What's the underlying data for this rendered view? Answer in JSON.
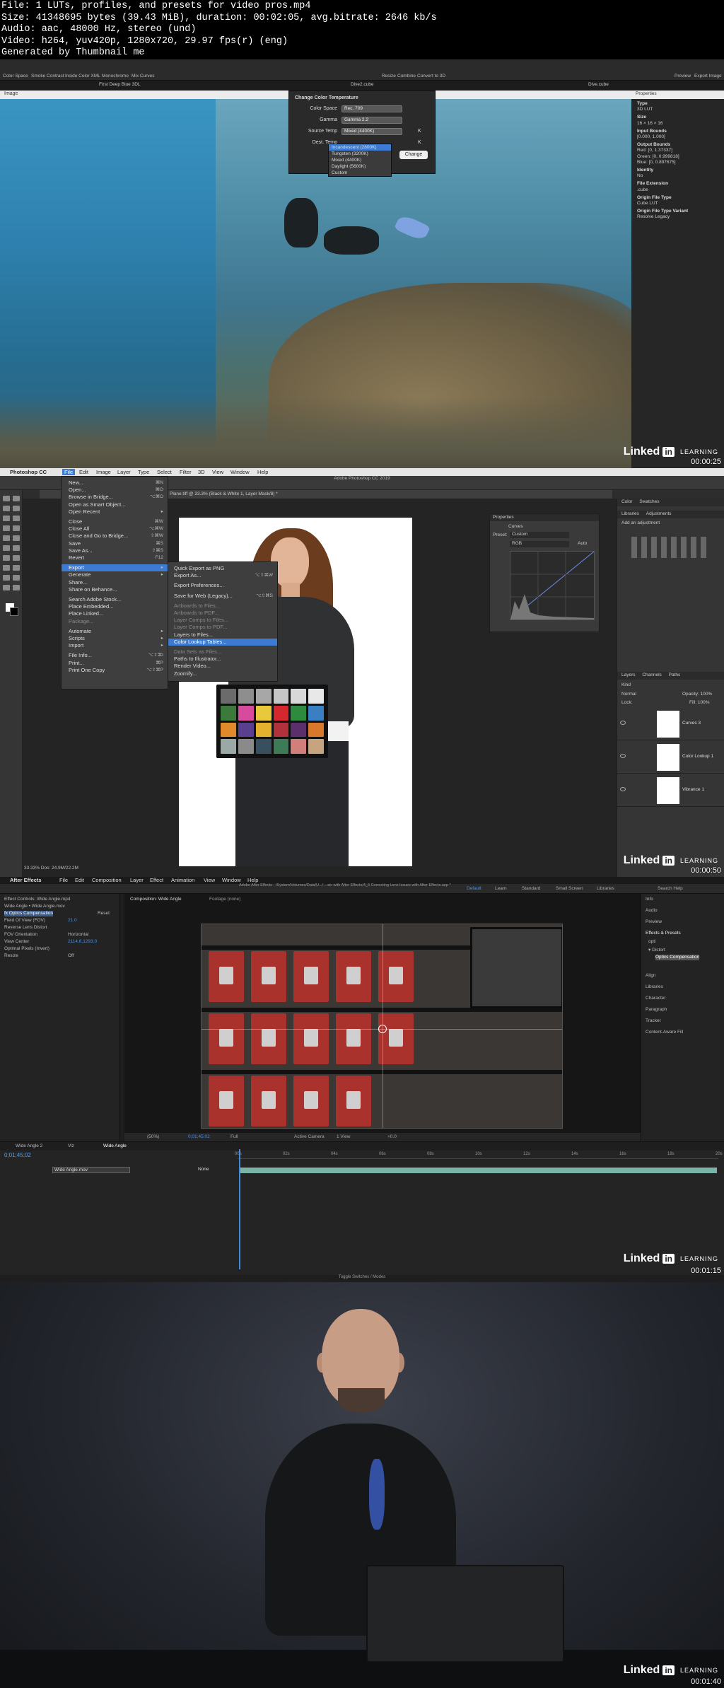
{
  "header": {
    "lines": [
      "File: 1 LUTs, profiles, and presets for video pros.mp4",
      "Size: 41348695 bytes (39.43 MiB), duration: 00:02:05, avg.bitrate: 2646 kb/s",
      "Audio: aac, 48000 Hz, stereo (und)",
      "Video: h264, yuv420p, 1280x720, 29.97 fps(r) (eng)",
      "Generated by Thumbnail me"
    ]
  },
  "brand": {
    "in": "in",
    "linked": "Linked",
    "learning": "LEARNING"
  },
  "frames": {
    "f1": {
      "timestamp": "00:00:25",
      "toolbar": [
        "Color Space",
        "Smoke Contrast",
        "Inside Color XML",
        "Monochrome",
        "Mix Curves"
      ],
      "toolbar_right": [
        "Resize",
        "Combine",
        "Convert to 3D"
      ],
      "toolbar_far": [
        "Preview",
        "Export Image"
      ],
      "title_left": "First Deep Blue 3DL",
      "title_center": "Dive2.cube",
      "title_right": "Dive.cube",
      "viewer_tab": "Image",
      "dialog": {
        "title": "Change Color Temperature",
        "color_space_label": "Color Space",
        "color_space_value": "Rec. 709",
        "gamma_label": "Gamma",
        "gamma_value": "Gamma 2.2",
        "source_label": "Source Temp",
        "source_value": "Mixed (4400K)",
        "dest_label": "Dest. Temp",
        "dest_options": [
          "Incandescent (2800K)",
          "Tungsten (3200K)",
          "Mixed (4400K)",
          "Daylight (5600K)",
          "Custom"
        ],
        "change_button": "Change"
      },
      "properties": {
        "tab": "Properties",
        "rows": [
          {
            "k": "Type",
            "v": "3D LUT"
          },
          {
            "k": "Size",
            "v": "16 × 16 × 16"
          },
          {
            "k": "Input Bounds",
            "v": "[0.000, 1.000]"
          },
          {
            "k": "Output Bounds",
            "v": "Red: [0, 1.37337]\nGreen: [0, 0.999818]\nBlue: [0, 0.897675]"
          },
          {
            "k": "Identity",
            "v": "No"
          },
          {
            "k": "File Extension",
            "v": ".cube"
          },
          {
            "k": "Origin File Type",
            "v": "Cube LUT"
          },
          {
            "k": "Origin File Type Variant",
            "v": "Resolve Legacy"
          }
        ]
      }
    },
    "f2": {
      "timestamp": "00:00:50",
      "menubar": [
        "Photoshop CC",
        "File",
        "Edit",
        "Image",
        "Layer",
        "Type",
        "Select",
        "Filter",
        "3D",
        "View",
        "Window",
        "Help"
      ],
      "window_title": "Adobe Photoshop CC 2019",
      "doc_tab": "Plane.tiff @ 33.3% (Black & White 1, Layer Mask/8) *",
      "file_menu": [
        {
          "label": "New...",
          "sc": "⌘N"
        },
        {
          "label": "Open...",
          "sc": "⌘O"
        },
        {
          "label": "Browse in Bridge...",
          "sc": "⌥⌘O"
        },
        {
          "label": "Open as Smart Object...",
          "sc": ""
        },
        {
          "label": "Open Recent",
          "sc": "▸"
        },
        {
          "label": "Close",
          "sc": "⌘W"
        },
        {
          "label": "Close All",
          "sc": "⌥⌘W"
        },
        {
          "label": "Close and Go to Bridge...",
          "sc": "⇧⌘W"
        },
        {
          "label": "Save",
          "sc": "⌘S"
        },
        {
          "label": "Save As...",
          "sc": "⇧⌘S"
        },
        {
          "label": "Revert",
          "sc": "F12"
        },
        {
          "label": "Export",
          "sc": "▸"
        },
        {
          "label": "Generate",
          "sc": "▸"
        },
        {
          "label": "Share...",
          "sc": ""
        },
        {
          "label": "Share on Behance...",
          "sc": ""
        },
        {
          "label": "Search Adobe Stock...",
          "sc": ""
        },
        {
          "label": "Place Embedded...",
          "sc": ""
        },
        {
          "label": "Place Linked...",
          "sc": ""
        },
        {
          "label": "Package...",
          "sc": ""
        },
        {
          "label": "Automate",
          "sc": "▸"
        },
        {
          "label": "Scripts",
          "sc": "▸"
        },
        {
          "label": "Import",
          "sc": "▸"
        },
        {
          "label": "File Info...",
          "sc": "⌥⇧⌘I"
        },
        {
          "label": "Print...",
          "sc": "⌘P"
        },
        {
          "label": "Print One Copy",
          "sc": "⌥⇧⌘P"
        }
      ],
      "export_menu": [
        {
          "label": "Quick Export as PNG",
          "sc": ""
        },
        {
          "label": "Export As...",
          "sc": "⌥⇧⌘W"
        },
        {
          "label": "Export Preferences...",
          "sc": ""
        },
        {
          "label": "Save for Web (Legacy)...",
          "sc": "⌥⇧⌘S"
        },
        {
          "label": "Artboards to Files...",
          "sc": ""
        },
        {
          "label": "Artboards to PDF...",
          "sc": ""
        },
        {
          "label": "Layer Comps to Files...",
          "sc": ""
        },
        {
          "label": "Layer Comps to PDF...",
          "sc": ""
        },
        {
          "label": "Layers to Files...",
          "sc": ""
        },
        {
          "label": "Color Lookup Tables...",
          "sc": ""
        },
        {
          "label": "Data Sets as Files...",
          "sc": ""
        },
        {
          "label": "Paths to Illustrator...",
          "sc": ""
        },
        {
          "label": "Render Video...",
          "sc": ""
        },
        {
          "label": "Zoomify...",
          "sc": ""
        }
      ],
      "properties": {
        "title": "Properties",
        "panel": "Curves",
        "preset_label": "Preset:",
        "preset_value": "Custom",
        "channel": "RGB",
        "auto": "Auto"
      },
      "right_panel": {
        "tabs": [
          "Color",
          "Swatches"
        ],
        "tabs2": [
          "Libraries",
          "Adjustments"
        ],
        "add": "Add an adjustment",
        "layers_tabs": [
          "Layers",
          "Channels",
          "Paths"
        ],
        "kind": "Kind",
        "blend": "Normal",
        "opacity": "Opacity: 100%",
        "fill": "Fill: 100%",
        "lock": "Lock:"
      },
      "layers": [
        "Curves 3",
        "Color Lookup 1",
        "Vibrance 1"
      ],
      "status": "33.33%    Doc: 24.9M/22.2M",
      "colors": {
        "checker": [
          "#6b6b6b",
          "#8e8e8e",
          "#a7a7a7",
          "#c6c6c6",
          "#d8d8d8",
          "#e8e8e8",
          "#3b7a3a",
          "#d64b9c",
          "#e8c93b",
          "#d4272e",
          "#2e8a3f",
          "#3a7fc2",
          "#e08a2b",
          "#5b3f8f",
          "#e3b12d",
          "#b2323c",
          "#5a2f6b",
          "#d8782c",
          "#9aa9a5",
          "#8a8a8a",
          "#38505e",
          "#3d7a55",
          "#d07f7b",
          "#c6a47f"
        ]
      }
    },
    "f3": {
      "timestamp": "00:01:15",
      "menubar": [
        "After Effects",
        "File",
        "Edit",
        "Composition",
        "Layer",
        "Effect",
        "Animation",
        "View",
        "Window",
        "Help"
      ],
      "doc_title": "Adobe After Effects - /System/Volumes/Data/U.../ ...sic with After Effects/4_5 Correcting Lens Issues with After Effects.aep *",
      "workspaces": [
        "Default",
        "Learn",
        "Standard",
        "Small Screen",
        "Libraries"
      ],
      "search": "Search Help",
      "left_panel": [
        "Effect Controls: Wide Angle.mp4",
        "Wide Angle • Wide Angle.mov",
        "fx  Optics Compensation",
        "Field Of View (FOV)",
        "Reverse Lens Distort",
        "FOV Orientation",
        "View Center",
        "Optimal Pixels (Invert)",
        "Resize"
      ],
      "left_values": [
        "Reset",
        "21.0",
        "Horizontal",
        "2114.6,1293.0",
        "Off"
      ],
      "comp_tab": "Composition: Wide Angle",
      "footage_tab": "Footage (none)",
      "right_panel": [
        "Info",
        "Audio",
        "Preview",
        "Effects & Presets",
        "opti",
        "▾ Distort",
        "Optics Compensation",
        "Align",
        "Libraries",
        "Character",
        "Paragraph",
        "Tracker",
        "Content-Aware Fill"
      ],
      "viewbar": [
        "(50%)",
        "0;01;45;02",
        "Full",
        "Active Camera",
        "1 View",
        "+0.0"
      ],
      "timeline_tabs": [
        "Wide Angle 2",
        "Viz",
        "Wide Angle"
      ],
      "timecode": "0;01;45;02",
      "layer_name": "Wide Angle.mov",
      "parent": "None",
      "footer": "Toggle Switches / Modes",
      "ruler_marks": [
        "00s",
        "02s",
        "04s",
        "06s",
        "08s",
        "10s",
        "12s",
        "14s",
        "16s",
        "18s",
        "20s"
      ]
    },
    "f4": {
      "timestamp": "00:01:40"
    }
  }
}
